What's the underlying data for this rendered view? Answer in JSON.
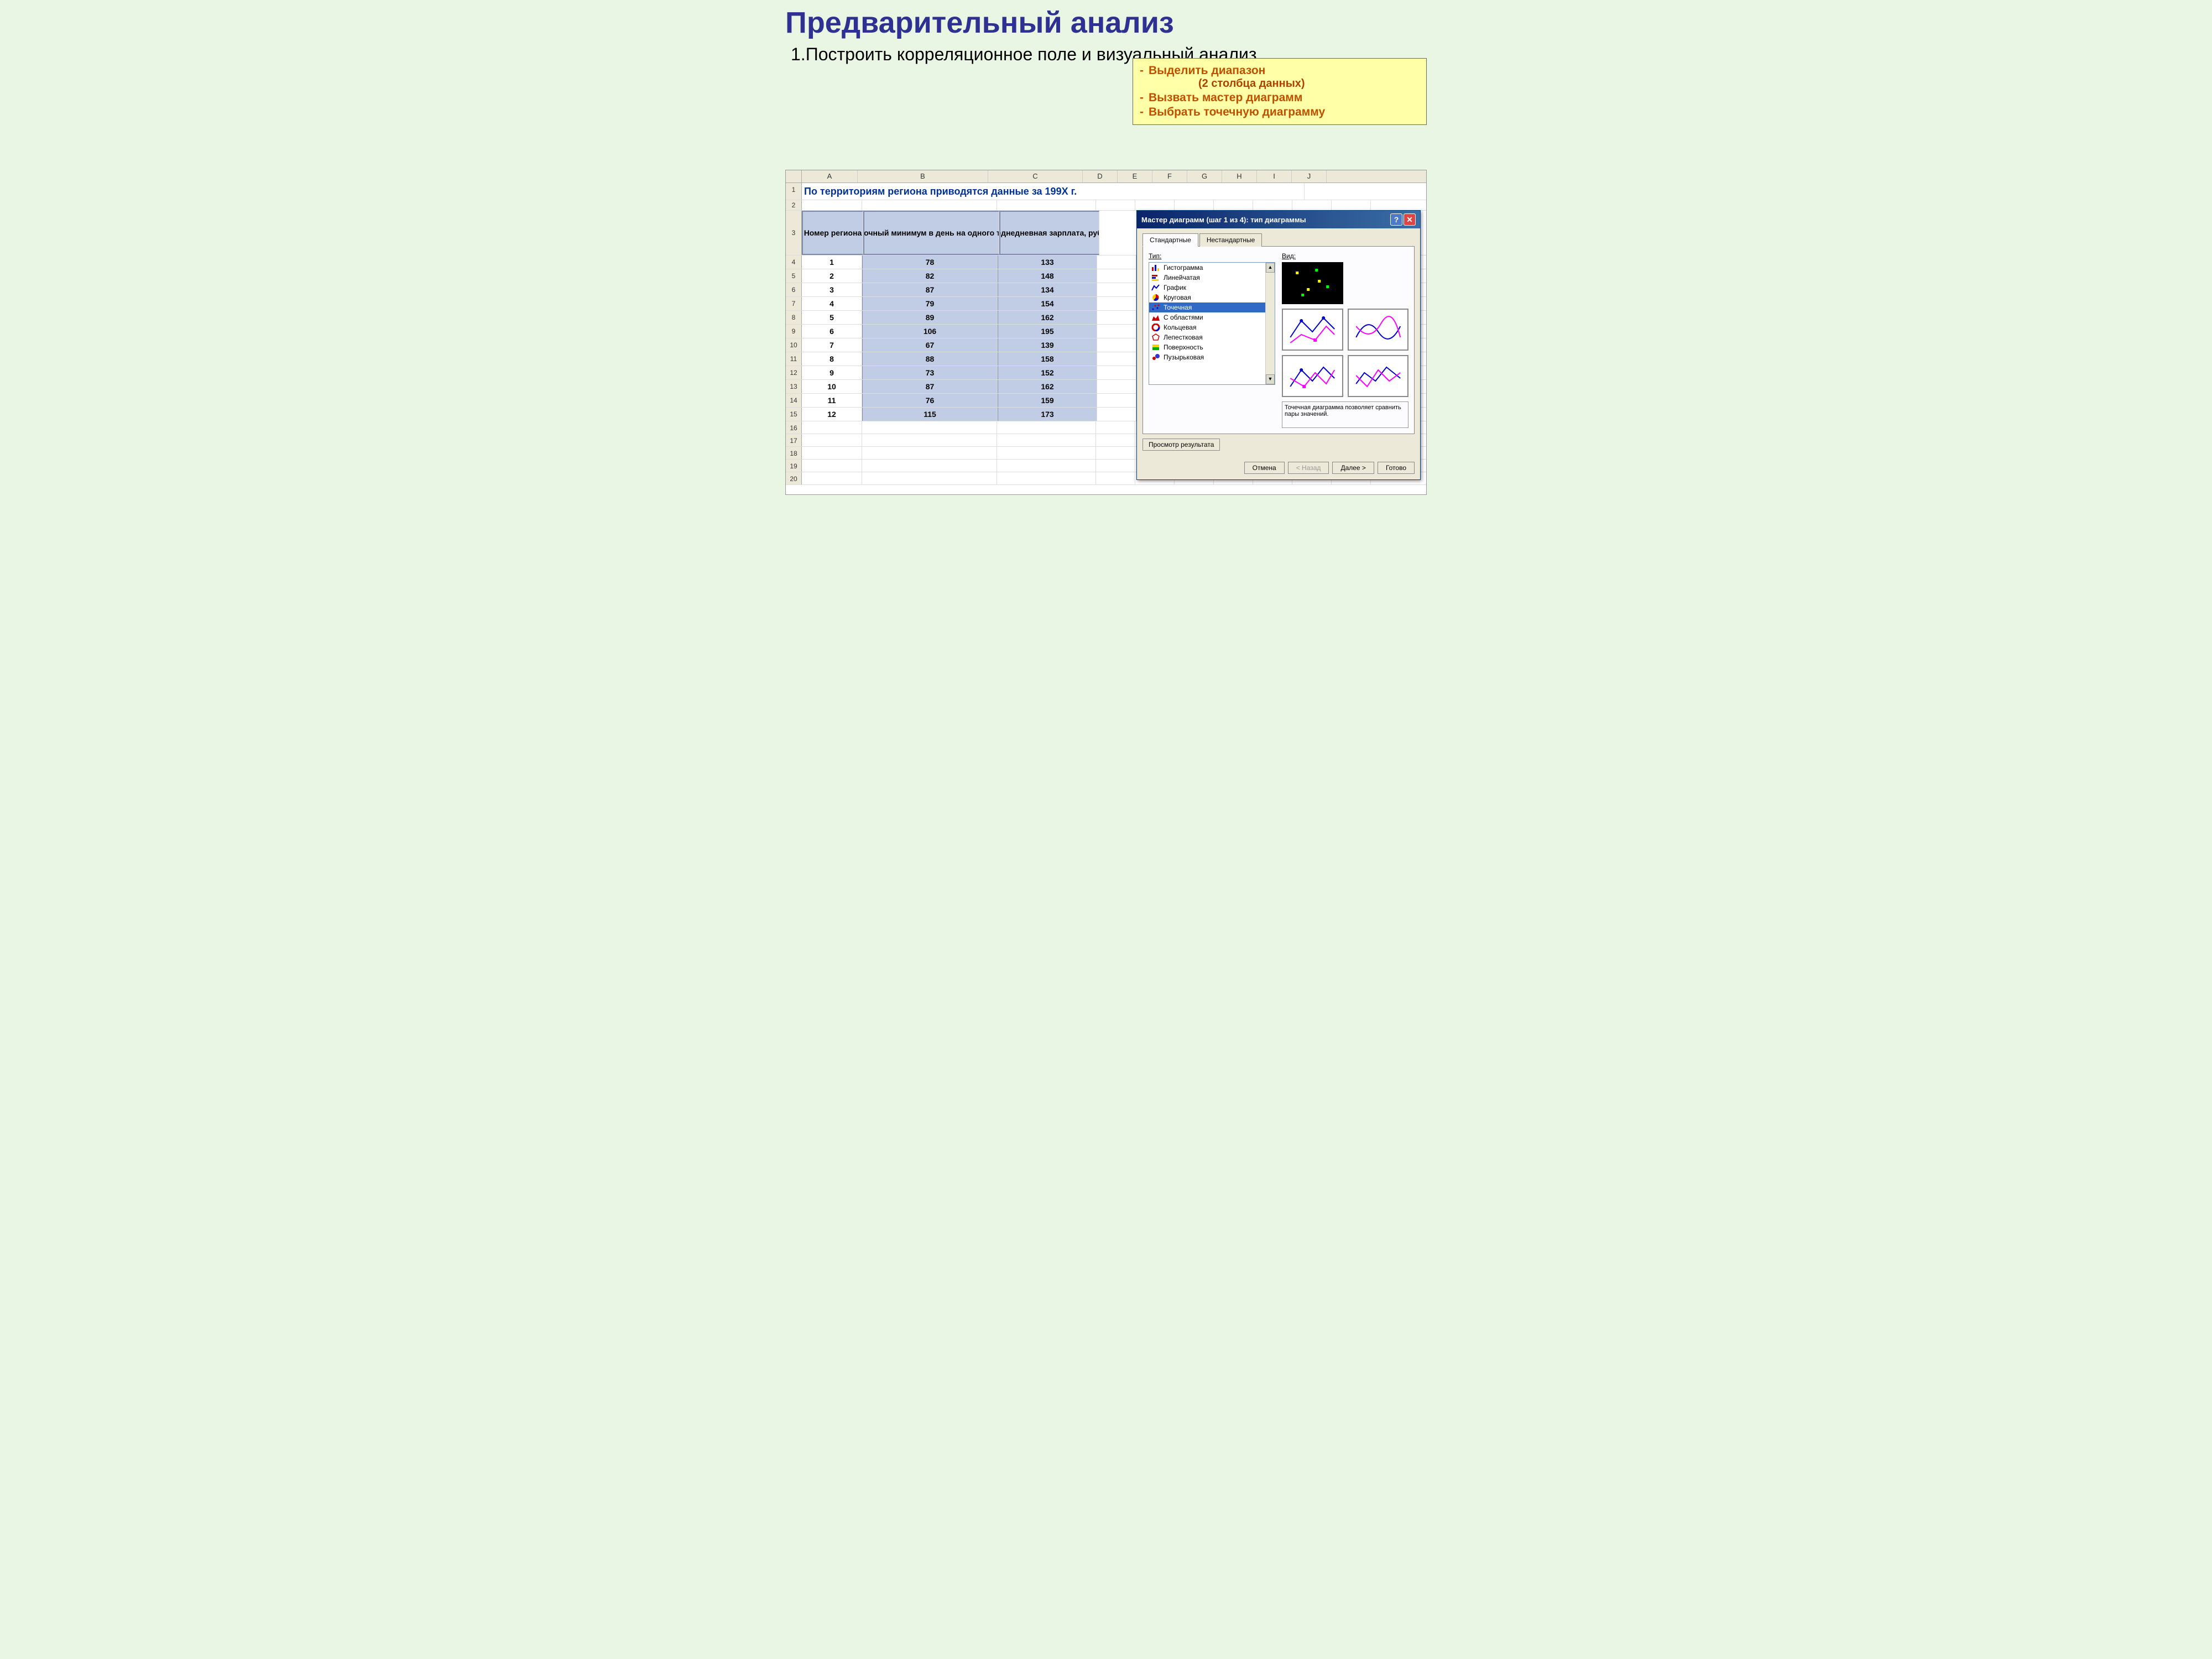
{
  "title": "Предварительный анализ",
  "subtitle": "1.Построить корреляционное поле и визуальный анализ",
  "tips": {
    "t1": "Выделить диапазон",
    "t1sub": "(2 столбца данных)",
    "t2": "Вызвать мастер диаграмм",
    "t3": "Выбрать точечную диаграмму"
  },
  "sheet": {
    "cols": [
      "A",
      "B",
      "C",
      "D",
      "E",
      "F",
      "G",
      "H",
      "I",
      "J"
    ],
    "row1": "По территориям региона приводятся данные за 199X г.",
    "headers": {
      "a": "Номер региона",
      "b": "Среднедушевой прожиточный минимум в день на одного трудоспособного, руб., x",
      "c": "Среднедневная зарплата, руб., y"
    },
    "rows": [
      {
        "n": "4",
        "a": "1",
        "b": "78",
        "c": "133"
      },
      {
        "n": "5",
        "a": "2",
        "b": "82",
        "c": "148"
      },
      {
        "n": "6",
        "a": "3",
        "b": "87",
        "c": "134"
      },
      {
        "n": "7",
        "a": "4",
        "b": "79",
        "c": "154"
      },
      {
        "n": "8",
        "a": "5",
        "b": "89",
        "c": "162"
      },
      {
        "n": "9",
        "a": "6",
        "b": "106",
        "c": "195"
      },
      {
        "n": "10",
        "a": "7",
        "b": "67",
        "c": "139"
      },
      {
        "n": "11",
        "a": "8",
        "b": "88",
        "c": "158"
      },
      {
        "n": "12",
        "a": "9",
        "b": "73",
        "c": "152"
      },
      {
        "n": "13",
        "a": "10",
        "b": "87",
        "c": "162"
      },
      {
        "n": "14",
        "a": "11",
        "b": "76",
        "c": "159"
      },
      {
        "n": "15",
        "a": "12",
        "b": "115",
        "c": "173"
      }
    ],
    "empty_rows": [
      "16",
      "17",
      "18",
      "19",
      "20"
    ]
  },
  "wizard": {
    "title": "Мастер диаграмм (шаг 1 из 4): тип диаграммы",
    "tab_std": "Стандартные",
    "tab_custom": "Нестандартные",
    "type_label": "Тип:",
    "view_label": "Вид:",
    "types": [
      "Гистограмма",
      "Линейчатая",
      "График",
      "Круговая",
      "Точечная",
      "С областями",
      "Кольцевая",
      "Лепестковая",
      "Поверхность",
      "Пузырьковая"
    ],
    "selected_type_index": 4,
    "desc": "Точечная диаграмма позволяет сравнить пары значений.",
    "preview_btn": "Просмотр результата",
    "btn_cancel": "Отмена",
    "btn_back": "< Назад",
    "btn_next": "Далее >",
    "btn_finish": "Готово"
  }
}
